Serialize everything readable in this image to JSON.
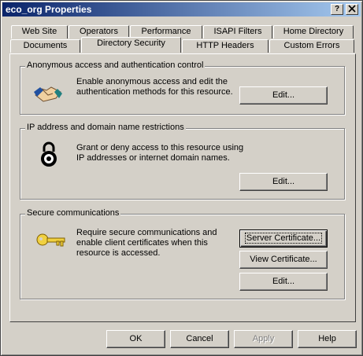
{
  "window": {
    "title": "eco_org Properties",
    "help_btn": "?",
    "close_btn": "X"
  },
  "tabs_back": [
    "Web Site",
    "Operators",
    "Performance",
    "ISAPI Filters",
    "Home Directory"
  ],
  "tabs_front": [
    "Documents",
    "Directory Security",
    "HTTP Headers",
    "Custom Errors"
  ],
  "active_tab": "Directory Security",
  "anon": {
    "label": "Anonymous access and authentication control",
    "line1": "Enable anonymous access and edit the",
    "line2": "authentication methods for this resource.",
    "edit": "Edit..."
  },
  "ip": {
    "label": "IP address and domain name restrictions",
    "line1": "Grant or deny access to this resource using",
    "line2": "IP addresses or internet domain names.",
    "edit": "Edit..."
  },
  "secure": {
    "label": "Secure communications",
    "line1": "Require secure communications and",
    "line2": "enable client certificates when this",
    "line3": "resource is accessed.",
    "server_cert": "Server Certificate...",
    "view_cert": "View Certificate...",
    "edit": "Edit..."
  },
  "footer": {
    "ok": "OK",
    "cancel": "Cancel",
    "apply": "Apply",
    "help": "Help"
  },
  "colors": {
    "titlebar_start": "#0a246a",
    "titlebar_end": "#a6caf0",
    "face": "#d4d0c8"
  }
}
